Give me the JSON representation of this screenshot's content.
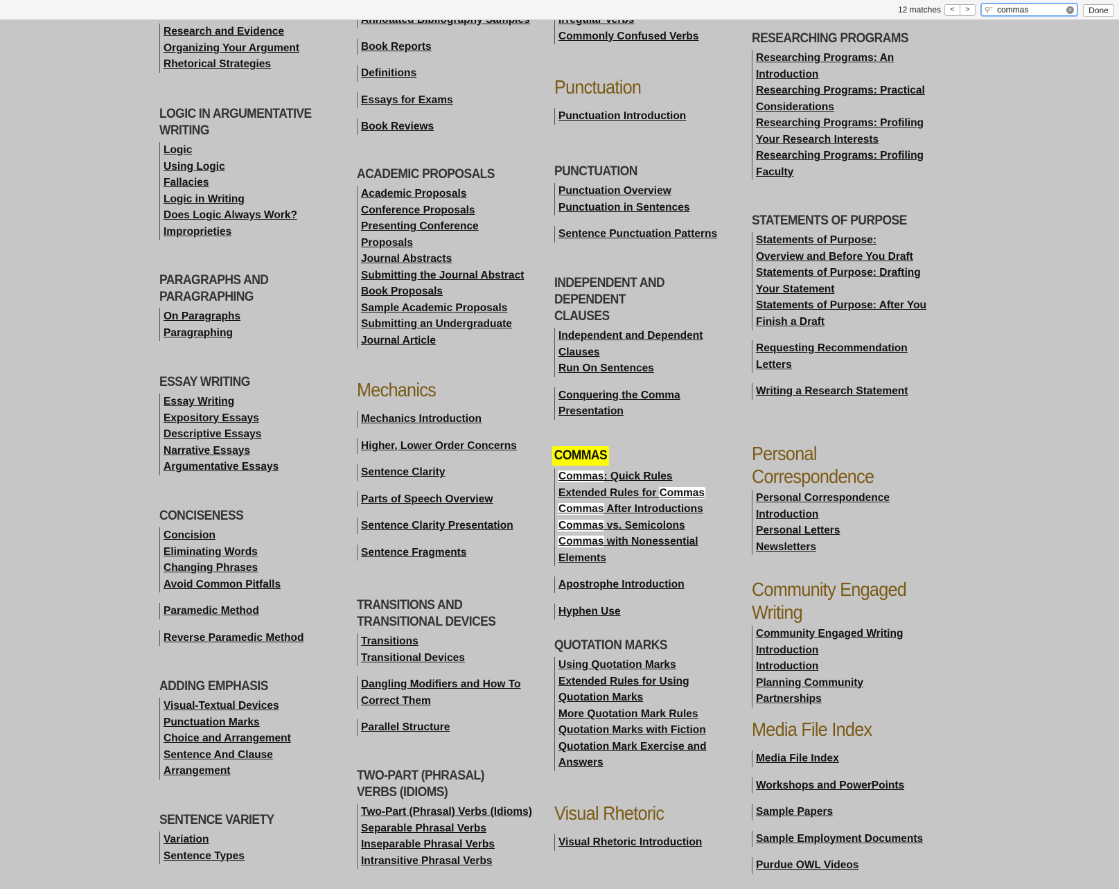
{
  "findbar": {
    "match_count": "12 matches",
    "prev_label": "<",
    "next_label": ">",
    "query": "commas",
    "search_icon": "magnifier-icon",
    "clear_icon": "clear-circle-icon",
    "done_label": "Done"
  },
  "col1": {
    "partial_top": [
      "Research and Evidence",
      "Organizing Your Argument",
      "Rhetorical Strategies"
    ],
    "logic": {
      "heading": "LOGIC IN ARGUMENTATIVE WRITING",
      "links": [
        "Logic",
        "Using Logic",
        "Fallacies",
        "Logic in Writing",
        "Does Logic Always Work?",
        "Improprieties"
      ]
    },
    "paragraphs": {
      "heading": "PARAGRAPHS AND PARAGRAPHING",
      "links": [
        "On Paragraphs",
        "Paragraphing"
      ]
    },
    "essay": {
      "heading": "ESSAY WRITING",
      "links": [
        "Essay Writing",
        "Expository Essays",
        "Descriptive Essays",
        "Narrative Essays",
        "Argumentative Essays"
      ]
    },
    "concise": {
      "heading": "CONCISENESS",
      "links": [
        "Concision",
        "Eliminating Words",
        "Changing Phrases",
        "Avoid Common Pitfalls"
      ],
      "extra1": "Paramedic Method",
      "extra2": "Reverse Paramedic Method"
    },
    "emphasis": {
      "heading": "ADDING EMPHASIS",
      "links": [
        "Visual-Textual Devices",
        "Punctuation Marks",
        "Choice and Arrangement",
        "Sentence And Clause Arrangement"
      ]
    },
    "variety": {
      "heading": "SENTENCE VARIETY",
      "links": [
        "Variation",
        "Sentence Types"
      ]
    }
  },
  "col2": {
    "partial_top": "Annotated Bibliography Samples",
    "singles": [
      "Book Reports",
      "Definitions",
      "Essays for Exams",
      "Book Reviews"
    ],
    "proposals": {
      "heading": "ACADEMIC PROPOSALS",
      "links": [
        "Academic Proposals",
        "Conference Proposals",
        "Presenting Conference Proposals",
        "Journal Abstracts",
        "Submitting the Journal Abstract",
        "Book Proposals",
        "Sample Academic Proposals",
        "Submitting an Undergraduate Journal Article"
      ]
    },
    "mechanics": {
      "heading": "Mechanics",
      "singles": [
        "Mechanics Introduction",
        "Higher, Lower Order Concerns",
        "Sentence Clarity",
        "Parts of Speech Overview",
        "Sentence Clarity Presentation",
        "Sentence Fragments"
      ]
    },
    "transitions": {
      "heading": "TRANSITIONS AND TRANSITIONAL DEVICES",
      "links": [
        "Transitions",
        "Transitional Devices"
      ],
      "extra1": "Dangling Modifiers and How To Correct Them",
      "extra2": "Parallel Structure"
    },
    "phrasal": {
      "heading": "TWO-PART (PHRASAL) VERBS (IDIOMS)",
      "links": [
        "Two-Part (Phrasal) Verbs (Idioms)",
        "Separable Phrasal Verbs",
        "Inseparable Phrasal Verbs",
        "Intransitive Phrasal Verbs"
      ]
    }
  },
  "col3": {
    "partial_top": [
      "Irregular Verbs",
      "Commonly Confused Verbs"
    ],
    "punct_section": {
      "heading": "Punctuation",
      "single": "Punctuation Introduction"
    },
    "punctuation": {
      "heading": "PUNCTUATION",
      "links": [
        "Punctuation Overview",
        "Punctuation in Sentences"
      ],
      "extra": "Sentence Punctuation Patterns"
    },
    "clauses": {
      "heading": "INDEPENDENT AND DEPENDENT CLAUSES",
      "links": [
        "Independent and Dependent Clauses",
        "Run On Sentences"
      ],
      "extra": "Conquering the Comma Presentation"
    },
    "commas": {
      "heading": "COMMAS",
      "link1_match": "Commas",
      "link1_rest": ": Quick Rules",
      "link2_pre": "Extended Rules for ",
      "link2_match": "Commas",
      "link3_match": "Commas",
      "link3_rest": " After Introductions",
      "link4_match": "Commas",
      "link4_rest": " vs. Semicolons",
      "link5_match": "Commas",
      "link5_rest": " with Nonessential Elements",
      "extra1": "Apostrophe Introduction",
      "extra2": "Hyphen Use"
    },
    "quotes": {
      "heading": "QUOTATION MARKS",
      "links": [
        "Using Quotation Marks",
        "Extended Rules for Using Quotation Marks",
        "More Quotation Mark Rules",
        "Quotation Marks with Fiction",
        "Quotation Mark Exercise and Answers"
      ]
    },
    "visual": {
      "heading": "Visual Rhetoric",
      "single": "Visual Rhetoric Introduction"
    }
  },
  "col4": {
    "research": {
      "heading": "RESEARCHING PROGRAMS",
      "links": [
        "Researching Programs: An Introduction",
        "Researching Programs: Practical Considerations",
        "Researching Programs: Profiling Your Research Interests",
        "Researching Programs: Profiling Faculty"
      ]
    },
    "statements": {
      "heading": "STATEMENTS OF PURPOSE",
      "links": [
        "Statements of Purpose: Overview and Before You Draft",
        "Statements of Purpose: Drafting Your Statement",
        "Statements of Purpose: After You Finish a Draft"
      ],
      "extra1": "Requesting Recommendation Letters",
      "extra2": "Writing a Research Statement"
    },
    "personal": {
      "heading": "Personal Correspondence",
      "links": [
        "Personal Correspondence Introduction",
        "Personal Letters",
        "Newsletters"
      ]
    },
    "community": {
      "heading": "Community Engaged Writing",
      "links": [
        "Community Engaged Writing Introduction",
        "Introduction",
        "Planning Community Partnerships"
      ]
    },
    "media": {
      "heading": "Media File Index",
      "singles": [
        "Media File Index",
        "Workshops and PowerPoints",
        "Sample Papers",
        "Sample Employment Documents",
        "Purdue OWL Videos"
      ]
    }
  },
  "colors": {
    "heading_brown": "#7a5a14",
    "heading_gray": "#333333",
    "background": "#c6c6c6",
    "highlight": "#ffff00",
    "link": "#111111"
  }
}
